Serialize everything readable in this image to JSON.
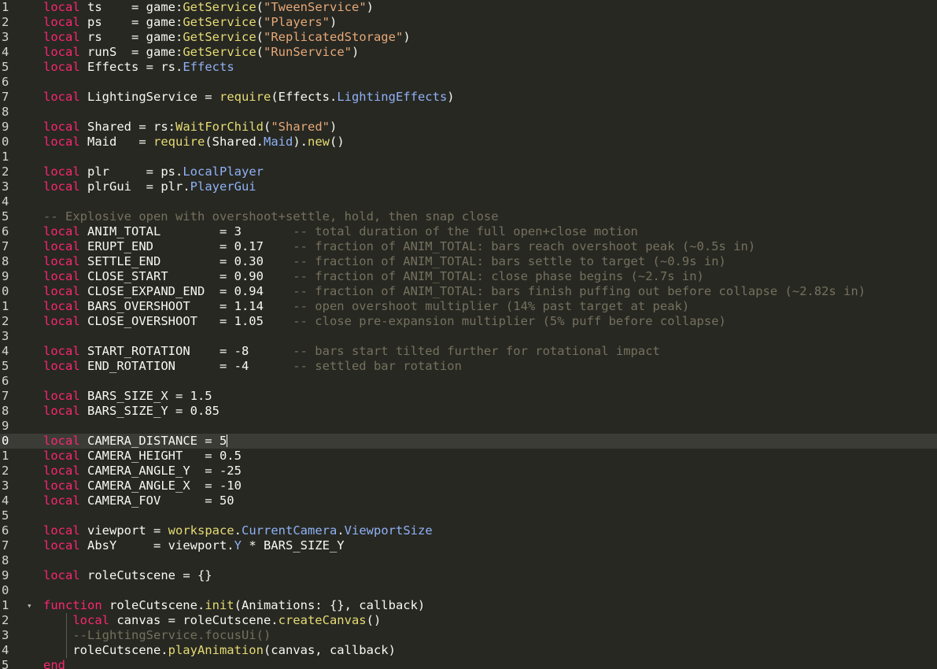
{
  "theme": {
    "background": "#272822",
    "current_line": "#3b3c36",
    "colors": {
      "kw": "#f92672",
      "fn": "#e6db74",
      "str": "#e6a878",
      "cm": "#75715e",
      "prop": "#8fb1f5",
      "id": "#f8f8f2",
      "num": "#f8f8f2",
      "op": "#f8f8f2"
    }
  },
  "editor": {
    "active_line": 30,
    "cursor_after_token": true,
    "lines": [
      {
        "n": "1",
        "t": [
          [
            "kw",
            "local"
          ],
          [
            "id",
            " ts    = game:"
          ],
          [
            "fn",
            "GetService"
          ],
          [
            "id",
            "("
          ],
          [
            "str",
            "\"TweenService\""
          ],
          [
            "id",
            ")"
          ]
        ]
      },
      {
        "n": "2",
        "t": [
          [
            "kw",
            "local"
          ],
          [
            "id",
            " ps    = game:"
          ],
          [
            "fn",
            "GetService"
          ],
          [
            "id",
            "("
          ],
          [
            "str",
            "\"Players\""
          ],
          [
            "id",
            ")"
          ]
        ]
      },
      {
        "n": "3",
        "t": [
          [
            "kw",
            "local"
          ],
          [
            "id",
            " rs    = game:"
          ],
          [
            "fn",
            "GetService"
          ],
          [
            "id",
            "("
          ],
          [
            "str",
            "\"ReplicatedStorage\""
          ],
          [
            "id",
            ")"
          ]
        ]
      },
      {
        "n": "4",
        "t": [
          [
            "kw",
            "local"
          ],
          [
            "id",
            " runS  = game:"
          ],
          [
            "fn",
            "GetService"
          ],
          [
            "id",
            "("
          ],
          [
            "str",
            "\"RunService\""
          ],
          [
            "id",
            ")"
          ]
        ]
      },
      {
        "n": "5",
        "t": [
          [
            "kw",
            "local"
          ],
          [
            "id",
            " Effects = rs."
          ],
          [
            "prop",
            "Effects"
          ]
        ]
      },
      {
        "n": "6",
        "t": []
      },
      {
        "n": "7",
        "t": [
          [
            "kw",
            "local"
          ],
          [
            "id",
            " LightingService = "
          ],
          [
            "fn",
            "require"
          ],
          [
            "id",
            "(Effects."
          ],
          [
            "prop",
            "LightingEffects"
          ],
          [
            "id",
            ")"
          ]
        ]
      },
      {
        "n": "8",
        "t": []
      },
      {
        "n": "9",
        "t": [
          [
            "kw",
            "local"
          ],
          [
            "id",
            " Shared = rs:"
          ],
          [
            "fn",
            "WaitForChild"
          ],
          [
            "id",
            "("
          ],
          [
            "str",
            "\"Shared\""
          ],
          [
            "id",
            ")"
          ]
        ]
      },
      {
        "n": "0",
        "t": [
          [
            "kw",
            "local"
          ],
          [
            "id",
            " Maid   = "
          ],
          [
            "fn",
            "require"
          ],
          [
            "id",
            "(Shared."
          ],
          [
            "prop",
            "Maid"
          ],
          [
            "id",
            ")."
          ],
          [
            "fn",
            "new"
          ],
          [
            "id",
            "()"
          ]
        ]
      },
      {
        "n": "1",
        "t": []
      },
      {
        "n": "2",
        "t": [
          [
            "kw",
            "local"
          ],
          [
            "id",
            " plr     = ps."
          ],
          [
            "prop",
            "LocalPlayer"
          ]
        ]
      },
      {
        "n": "3",
        "t": [
          [
            "kw",
            "local"
          ],
          [
            "id",
            " plrGui  = plr."
          ],
          [
            "prop",
            "PlayerGui"
          ]
        ]
      },
      {
        "n": "4",
        "t": []
      },
      {
        "n": "5",
        "t": [
          [
            "cm",
            "-- Explosive open with overshoot+settle, hold, then snap close"
          ]
        ]
      },
      {
        "n": "6",
        "t": [
          [
            "kw",
            "local"
          ],
          [
            "id",
            " ANIM_TOTAL        = 3       "
          ],
          [
            "cm",
            "-- total duration of the full open+close motion"
          ]
        ]
      },
      {
        "n": "7",
        "t": [
          [
            "kw",
            "local"
          ],
          [
            "id",
            " ERUPT_END         = 0.17    "
          ],
          [
            "cm",
            "-- fraction of ANIM_TOTAL: bars reach overshoot peak (~0.5s in)"
          ]
        ]
      },
      {
        "n": "8",
        "t": [
          [
            "kw",
            "local"
          ],
          [
            "id",
            " SETTLE_END        = 0.30    "
          ],
          [
            "cm",
            "-- fraction of ANIM_TOTAL: bars settle to target (~0.9s in)"
          ]
        ]
      },
      {
        "n": "9",
        "t": [
          [
            "kw",
            "local"
          ],
          [
            "id",
            " CLOSE_START       = 0.90    "
          ],
          [
            "cm",
            "-- fraction of ANIM_TOTAL: close phase begins (~2.7s in)"
          ]
        ]
      },
      {
        "n": "0",
        "t": [
          [
            "kw",
            "local"
          ],
          [
            "id",
            " CLOSE_EXPAND_END  = 0.94    "
          ],
          [
            "cm",
            "-- fraction of ANIM_TOTAL: bars finish puffing out before collapse (~2.82s in)"
          ]
        ]
      },
      {
        "n": "1",
        "t": [
          [
            "kw",
            "local"
          ],
          [
            "id",
            " BARS_OVERSHOOT    = 1.14    "
          ],
          [
            "cm",
            "-- open overshoot multiplier (14% past target at peak)"
          ]
        ]
      },
      {
        "n": "2",
        "t": [
          [
            "kw",
            "local"
          ],
          [
            "id",
            " CLOSE_OVERSHOOT   = 1.05    "
          ],
          [
            "cm",
            "-- close pre-expansion multiplier (5% puff before collapse)"
          ]
        ]
      },
      {
        "n": "3",
        "t": []
      },
      {
        "n": "4",
        "t": [
          [
            "kw",
            "local"
          ],
          [
            "id",
            " START_ROTATION    = -8      "
          ],
          [
            "cm",
            "-- bars start tilted further for rotational impact"
          ]
        ]
      },
      {
        "n": "5",
        "t": [
          [
            "kw",
            "local"
          ],
          [
            "id",
            " END_ROTATION      = -4      "
          ],
          [
            "cm",
            "-- settled bar rotation"
          ]
        ]
      },
      {
        "n": "6",
        "t": []
      },
      {
        "n": "7",
        "t": [
          [
            "kw",
            "local"
          ],
          [
            "id",
            " BARS_SIZE_X = 1.5"
          ]
        ]
      },
      {
        "n": "8",
        "t": [
          [
            "kw",
            "local"
          ],
          [
            "id",
            " BARS_SIZE_Y = 0.85"
          ]
        ]
      },
      {
        "n": "9",
        "t": []
      },
      {
        "n": "0",
        "t": [
          [
            "kw",
            "local"
          ],
          [
            "id",
            " CAMERA_DISTANCE = 5"
          ]
        ]
      },
      {
        "n": "1",
        "t": [
          [
            "kw",
            "local"
          ],
          [
            "id",
            " CAMERA_HEIGHT   = 0.5"
          ]
        ]
      },
      {
        "n": "2",
        "t": [
          [
            "kw",
            "local"
          ],
          [
            "id",
            " CAMERA_ANGLE_Y  = -25"
          ]
        ]
      },
      {
        "n": "3",
        "t": [
          [
            "kw",
            "local"
          ],
          [
            "id",
            " CAMERA_ANGLE_X  = -10"
          ]
        ]
      },
      {
        "n": "4",
        "t": [
          [
            "kw",
            "local"
          ],
          [
            "id",
            " CAMERA_FOV      = 50"
          ]
        ]
      },
      {
        "n": "5",
        "t": []
      },
      {
        "n": "6",
        "t": [
          [
            "kw",
            "local"
          ],
          [
            "id",
            " viewport = "
          ],
          [
            "fn",
            "workspace"
          ],
          [
            "id",
            "."
          ],
          [
            "prop",
            "CurrentCamera"
          ],
          [
            "id",
            "."
          ],
          [
            "prop",
            "ViewportSize"
          ]
        ]
      },
      {
        "n": "7",
        "t": [
          [
            "kw",
            "local"
          ],
          [
            "id",
            " AbsY     = viewport."
          ],
          [
            "prop",
            "Y"
          ],
          [
            "id",
            " * BARS_SIZE_Y"
          ]
        ]
      },
      {
        "n": "8",
        "t": []
      },
      {
        "n": "9",
        "t": [
          [
            "kw",
            "local"
          ],
          [
            "id",
            " roleCutscene = {}"
          ]
        ]
      },
      {
        "n": "0",
        "t": []
      },
      {
        "n": "1",
        "fold": true,
        "t": [
          [
            "kw",
            "function"
          ],
          [
            "id",
            " roleCutscene."
          ],
          [
            "fn",
            "init"
          ],
          [
            "id",
            "(Animations: {}, callback)"
          ]
        ]
      },
      {
        "n": "2",
        "guide": true,
        "t": [
          [
            "id",
            "    "
          ],
          [
            "kw",
            "local"
          ],
          [
            "id",
            " canvas = roleCutscene."
          ],
          [
            "fn",
            "createCanvas"
          ],
          [
            "id",
            "()"
          ]
        ]
      },
      {
        "n": "3",
        "guide": true,
        "t": [
          [
            "id",
            "    "
          ],
          [
            "cm",
            "--LightingService.focusUi()"
          ]
        ]
      },
      {
        "n": "4",
        "guide": true,
        "t": [
          [
            "id",
            "    roleCutscene."
          ],
          [
            "fn",
            "playAnimation"
          ],
          [
            "id",
            "(canvas, callback)"
          ]
        ]
      },
      {
        "n": "5",
        "t": [
          [
            "kw",
            "end"
          ]
        ]
      }
    ]
  }
}
